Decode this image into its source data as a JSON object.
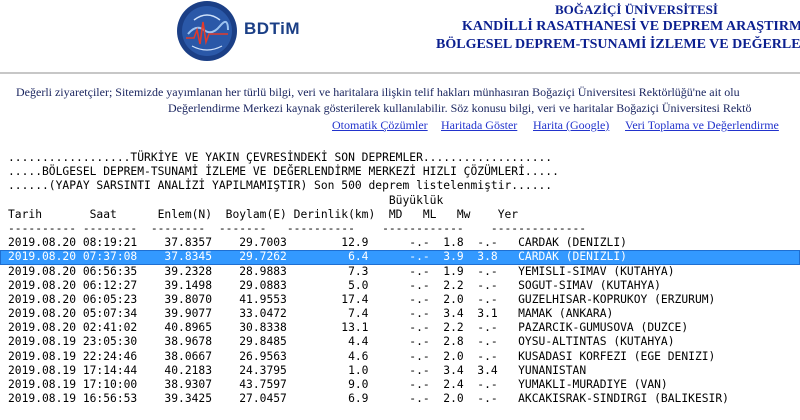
{
  "header": {
    "logo_text": "BDTiM",
    "line1": "BOĞAZİÇİ ÜNİVERSİTESİ",
    "line2": "KANDİLLİ RASATHANESİ VE DEPREM ARAŞTIRMA E",
    "line3": "BÖLGESEL DEPREM-TSUNAMİ İZLEME VE DEĞERLENDİ"
  },
  "notice": {
    "line1": "Değerli ziyaretçiler; Sitemizde yayımlanan her türlü bilgi, veri ve haritalara ilişkin telif hakları münhasıran Boğaziçi Üniversitesi Rektörlüğü'ne ait olu",
    "line2": "Değerlendirme Merkezi kaynak gösterilerek kullanılabilir. Söz konusu bilgi, veri ve haritalar Boğaziçi Üniversitesi Rektö"
  },
  "nav": {
    "link1": "Otomatik Çözümler",
    "link2": "Haritada Göster",
    "link3": "Harita (Google)",
    "link4": "Veri Toplama ve Değerlendirme"
  },
  "listing": {
    "title1": "..................TÜRKİYE VE YAKIN ÇEVRESİNDEKİ SON DEPREMLER...................",
    "title2": ".....BÖLGESEL DEPREM-TSUNAMİ İZLEME VE DEĞERLENDİRME MERKEZİ HIZLI ÇÖZÜMLERİ.....",
    "title3": "......(YAPAY SARSINTI ANALİZİ YAPILMAMIŞTIR) Son 500 deprem listelenmiştir......",
    "header_buyukluk": "                                                        Büyüklük",
    "header_cols": "Tarih       Saat      Enlem(N)  Boylam(E) Derinlik(km)  MD   ML   Mw    Yer",
    "separator": "---------- --------  --------  -------   ----------    ------------    --------------",
    "rows": [
      {
        "date": "2019.08.20",
        "time": "08:19:21",
        "lat": "37.8357",
        "lon": "29.7003",
        "depth": "12.9",
        "md": "-.-",
        "ml": "1.8",
        "mw": "-.-",
        "place": "CARDAK (DENIZLI)"
      },
      {
        "date": "2019.08.20",
        "time": "07:37:08",
        "lat": "37.8345",
        "lon": "29.7262",
        "depth": "6.4",
        "md": "-.-",
        "ml": "3.9",
        "mw": "3.8",
        "place": "CARDAK (DENIZLI)"
      },
      {
        "date": "2019.08.20",
        "time": "06:56:35",
        "lat": "39.2328",
        "lon": "28.9883",
        "depth": "7.3",
        "md": "-.-",
        "ml": "1.9",
        "mw": "-.-",
        "place": "YEMISLI-SIMAV (KUTAHYA)"
      },
      {
        "date": "2019.08.20",
        "time": "06:12:27",
        "lat": "39.1498",
        "lon": "29.0883",
        "depth": "5.0",
        "md": "-.-",
        "ml": "2.2",
        "mw": "-.-",
        "place": "SOGUT-SIMAV (KUTAHYA)"
      },
      {
        "date": "2019.08.20",
        "time": "06:05:23",
        "lat": "39.8070",
        "lon": "41.9553",
        "depth": "17.4",
        "md": "-.-",
        "ml": "2.0",
        "mw": "-.-",
        "place": "GUZELHISAR-KOPRUKOY (ERZURUM)"
      },
      {
        "date": "2019.08.20",
        "time": "05:07:34",
        "lat": "39.9077",
        "lon": "33.0472",
        "depth": "7.4",
        "md": "-.-",
        "ml": "3.4",
        "mw": "3.1",
        "place": "MAMAK (ANKARA)"
      },
      {
        "date": "2019.08.20",
        "time": "02:41:02",
        "lat": "40.8965",
        "lon": "30.8338",
        "depth": "13.1",
        "md": "-.-",
        "ml": "2.2",
        "mw": "-.-",
        "place": "PAZARCIK-GUMUSOVA (DUZCE)"
      },
      {
        "date": "2019.08.19",
        "time": "23:05:30",
        "lat": "38.9678",
        "lon": "29.8485",
        "depth": "4.4",
        "md": "-.-",
        "ml": "2.8",
        "mw": "-.-",
        "place": "OYSU-ALTINTAS (KUTAHYA)"
      },
      {
        "date": "2019.08.19",
        "time": "22:24:46",
        "lat": "38.0667",
        "lon": "26.9563",
        "depth": "4.6",
        "md": "-.-",
        "ml": "2.0",
        "mw": "-.-",
        "place": "KUSADASI KORFEZI (EGE DENIZI)"
      },
      {
        "date": "2019.08.19",
        "time": "17:14:44",
        "lat": "40.2183",
        "lon": "24.3795",
        "depth": "1.0",
        "md": "-.-",
        "ml": "3.4",
        "mw": "3.4",
        "place": "YUNANISTAN"
      },
      {
        "date": "2019.08.19",
        "time": "17:10:00",
        "lat": "38.9307",
        "lon": "43.7597",
        "depth": "9.0",
        "md": "-.-",
        "ml": "2.4",
        "mw": "-.-",
        "place": "YUMAKLI-MURADIYE (VAN)"
      },
      {
        "date": "2019.08.19",
        "time": "16:56:53",
        "lat": "39.3425",
        "lon": "27.0457",
        "depth": "6.9",
        "md": "-.-",
        "ml": "2.0",
        "mw": "-.-",
        "place": "AKCAKISRAK-SINDIRGI (BALIKESIR)"
      }
    ]
  }
}
